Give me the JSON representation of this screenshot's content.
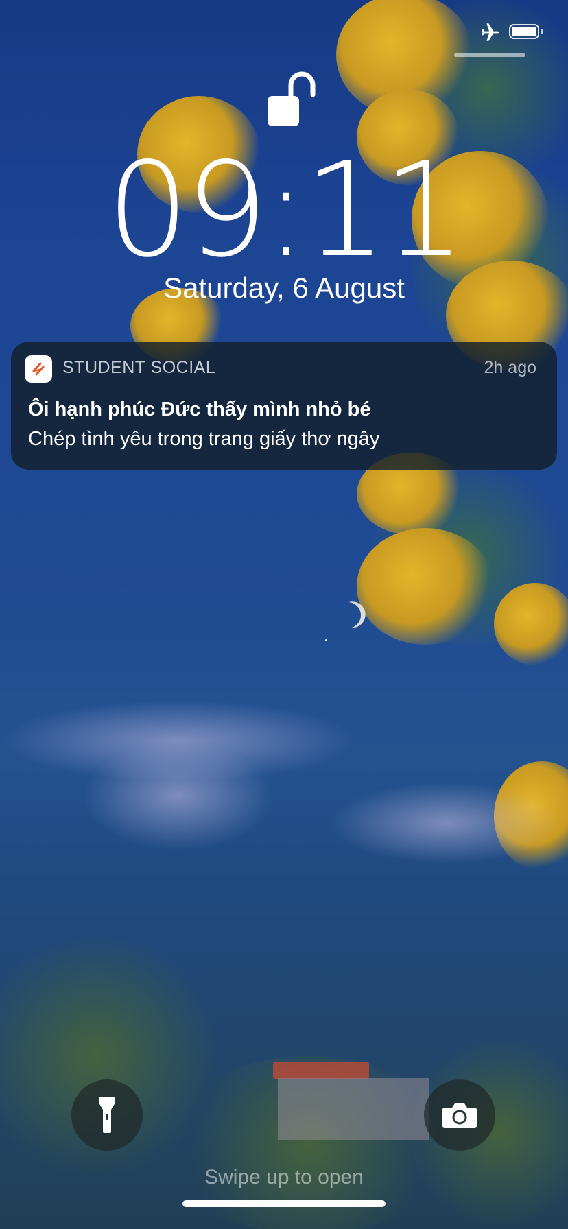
{
  "status_bar": {
    "airplane_icon": "airplane-icon",
    "battery_icon": "battery-icon"
  },
  "lock_screen": {
    "lock_icon": "unlocked-padlock-icon",
    "time": "09:11",
    "date": "Saturday, 6 August"
  },
  "notification": {
    "app_icon": "student-social-logo",
    "app_name": "STUDENT SOCIAL",
    "time": "2h ago",
    "title": "Ôi hạnh phúc Đức thấy mình nhỏ bé",
    "body": "Chép tình yêu trong trang giấy thơ ngây"
  },
  "bottom": {
    "flashlight_icon": "flashlight-icon",
    "camera_icon": "camera-icon",
    "swipe_hint": "Swipe up to open"
  },
  "colors": {
    "notification_bg": "#12202c",
    "app_accent": "#e8562a",
    "sky": "#1f4a94"
  }
}
